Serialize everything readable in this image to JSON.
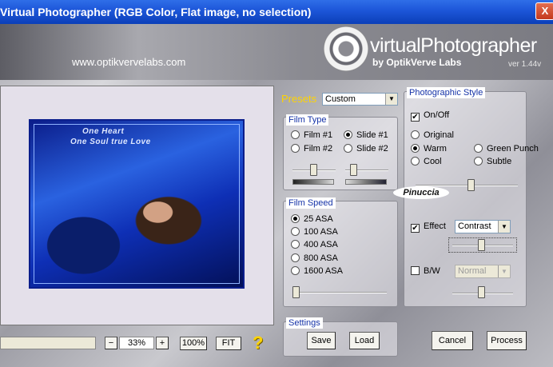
{
  "window": {
    "title": "Virtual Photographer (RGB Color, Flat image, no selection)",
    "close_label": "X"
  },
  "header": {
    "website": "www.optikvervelabs.com",
    "logo_text": "virtualPhotographer",
    "logo_sub": "by OptikVerve Labs",
    "version": "ver 1.44v"
  },
  "preview": {
    "title_line1": "One Heart",
    "title_line2": "One Soul true Love"
  },
  "zoom": {
    "minus_label": "−",
    "value": "33%",
    "plus_label": "+",
    "hundred_label": "100%",
    "fit_label": "FIT",
    "help_label": "?"
  },
  "presets": {
    "label": "Presets",
    "selected": "Custom"
  },
  "film_type": {
    "title": "Film Type",
    "options": [
      "Film #1",
      "Slide #1",
      "Film #2",
      "Slide #2"
    ],
    "selected": "Slide #1",
    "slider1_level": 0.42,
    "slider2_level": 0.2
  },
  "film_speed": {
    "title": "Film Speed",
    "options": [
      "25 ASA",
      "100 ASA",
      "400 ASA",
      "800 ASA",
      "1600 ASA"
    ],
    "selected": "25 ASA",
    "slider_level": 0.0
  },
  "settings": {
    "title": "Settings",
    "save_label": "Save",
    "load_label": "Load"
  },
  "photo_style": {
    "title": "Photographic Style",
    "onoff_label": "On/Off",
    "onoff_checked": true,
    "options": [
      "Original",
      "Warm",
      "Green Punch",
      "Cool",
      "Subtle"
    ],
    "selected": "Warm",
    "style_slider_level": 0.6,
    "signature": "Pinuccia",
    "effect_label": "Effect",
    "effect_checked": true,
    "effect_value": "Contrast",
    "effect_slider_level": 0.5,
    "bw_label": "B/W",
    "bw_checked": false,
    "bw_value": "Normal",
    "bw_slider_level": 0.5
  },
  "actions": {
    "cancel_label": "Cancel",
    "process_label": "Process"
  },
  "colors": {
    "titlebar": "#1c55d8",
    "presets_label": "#ffd400",
    "panel_title_text": "#1633a8"
  }
}
